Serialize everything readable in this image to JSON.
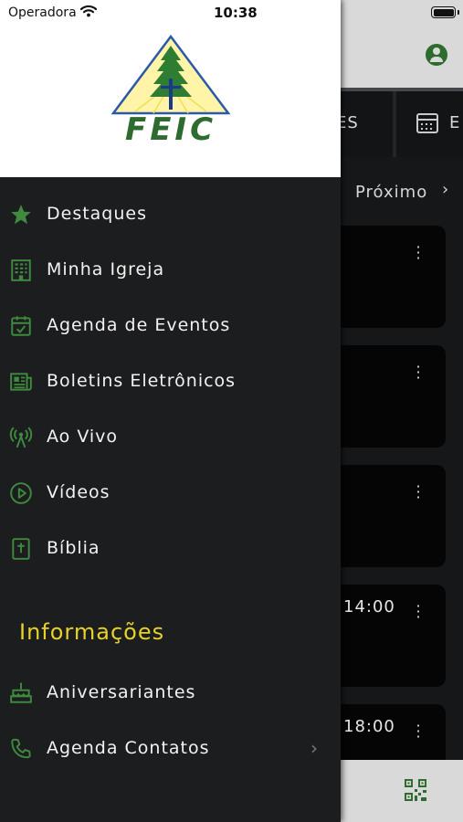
{
  "status_bar": {
    "carrier": "Operadora",
    "time": "10:38"
  },
  "background": {
    "tab_partial": "ES",
    "tab_partial2": "E",
    "next_label": "Próximo",
    "event_times": [
      "14:00",
      "18:00"
    ]
  },
  "drawer": {
    "logo_text": "FEIC",
    "menu": [
      {
        "label": "Destaques",
        "icon": "star-icon"
      },
      {
        "label": "Minha Igreja",
        "icon": "building-icon"
      },
      {
        "label": "Agenda de Eventos",
        "icon": "calendar-check-icon"
      },
      {
        "label": "Boletins Eletrônicos",
        "icon": "newspaper-icon"
      },
      {
        "label": "Ao Vivo",
        "icon": "broadcast-antenna-icon"
      },
      {
        "label": "Vídeos",
        "icon": "play-circle-icon"
      },
      {
        "label": "Bíblia",
        "icon": "bible-icon"
      }
    ],
    "section_title": "Informações",
    "info_menu": [
      {
        "label": "Aniversariantes",
        "icon": "cake-icon"
      },
      {
        "label": "Agenda Contatos",
        "icon": "phone-icon"
      }
    ]
  },
  "colors": {
    "accent_green": "#2e6b2e",
    "section_yellow": "#e7d12a",
    "drawer_bg": "#1c1d1f"
  }
}
